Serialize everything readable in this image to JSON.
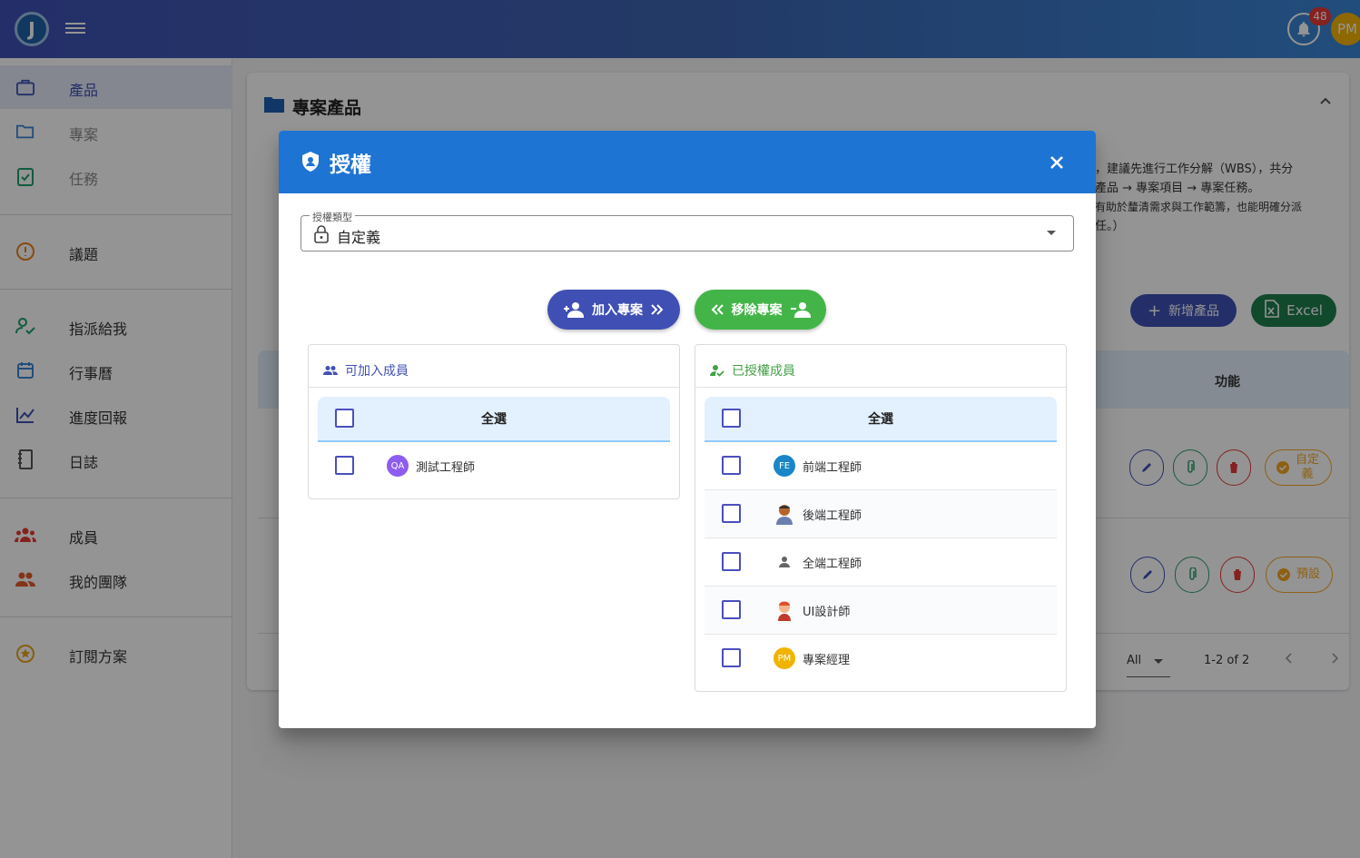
{
  "app": {
    "logo_letter": "J",
    "notifications_count": "48",
    "user_initials": "PM"
  },
  "sidebar": {
    "items": [
      {
        "label": "產品",
        "icon": "briefcase-icon"
      },
      {
        "label": "專案",
        "icon": "folder-open-icon"
      },
      {
        "label": "任務",
        "icon": "clipboard-check-icon"
      },
      {
        "label": "議題",
        "icon": "alert-circle-icon"
      },
      {
        "label": "指派給我",
        "icon": "user-check-icon"
      },
      {
        "label": "行事曆",
        "icon": "calendar-icon"
      },
      {
        "label": "進度回報",
        "icon": "line-chart-icon"
      },
      {
        "label": "日誌",
        "icon": "notebook-icon"
      },
      {
        "label": "成員",
        "icon": "group-icon"
      },
      {
        "label": "我的團隊",
        "icon": "team-icon"
      },
      {
        "label": "訂閱方案",
        "icon": "star-circle-icon"
      }
    ]
  },
  "main": {
    "title": "專案產品",
    "info_lines": [
      "，建議先進行工作分解（WBS），共分",
      "產品 → 專案項目 → 專案任務。",
      "有助於釐清需求與工作範籌，也能明確分派",
      "任。）"
    ],
    "add_button": "新增產品",
    "excel_button": "Excel",
    "table_func_header": "功能",
    "row_actions": [
      {
        "perm_label": "自定義"
      },
      {
        "perm_label": "預設"
      }
    ],
    "pager": {
      "rows_per_page": "All",
      "range": "1-2 of 2"
    }
  },
  "dialog": {
    "title": "授權",
    "auth_type": {
      "label": "授權類型",
      "value": "自定義"
    },
    "join_button": "加入專案",
    "remove_button": "移除專案",
    "available": {
      "title": "可加入成員",
      "select_all": "全選",
      "members": [
        {
          "name": "測試工程師",
          "initials": "QA",
          "color": "#8e5cf0"
        }
      ]
    },
    "authorized": {
      "title": "已授權成員",
      "select_all": "全選",
      "members": [
        {
          "name": "前端工程師",
          "initials": "FE",
          "color": "#1a86c8"
        },
        {
          "name": "後端工程師",
          "initials": "",
          "color": "#b5652b"
        },
        {
          "name": "全端工程師",
          "initials": "",
          "color": "#9e9e9e"
        },
        {
          "name": "UI設計師",
          "initials": "",
          "color": "#e8844c"
        },
        {
          "name": "專案經理",
          "initials": "PM",
          "color": "#f0b400"
        }
      ]
    }
  }
}
